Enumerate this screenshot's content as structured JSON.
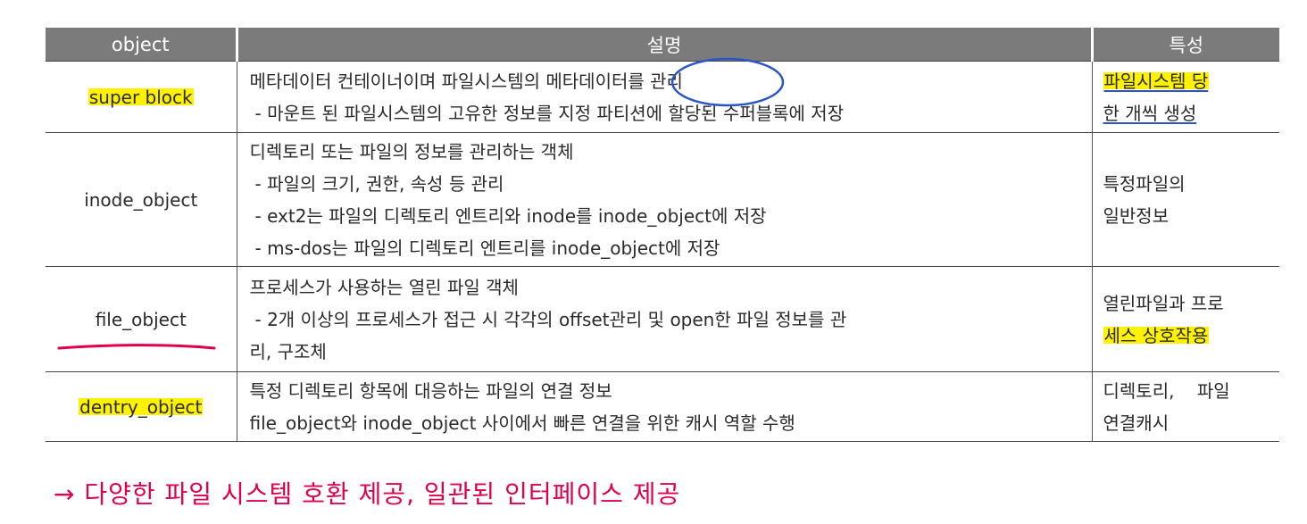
{
  "table": {
    "headers": {
      "object": "object",
      "desc": "설명",
      "trait": "특성"
    },
    "rows": {
      "super_block": {
        "object": "super block",
        "desc1": "메타데이터 컨테이너이며 파일시스템의 메타데이터를 관리",
        "desc2": "- 마운트 된 파일시스템의 고유한 정보를 지정 파티션에 할당된 수퍼블록에 저장",
        "trait1": "파일시스템 당",
        "trait2": "한 개씩 생성"
      },
      "inode": {
        "object": "inode_object",
        "desc1": "디렉토리 또는 파일의 정보를 관리하는 객체",
        "desc2": "- 파일의 크기, 권한, 속성 등 관리",
        "desc3": "- ext2는 파일의 디렉토리 엔트리와 inode를 inode_object에 저장",
        "desc4": "- ms-dos는 파일의 디렉토리 엔트리를 inode_object에 저장",
        "trait1": "특정파일의",
        "trait2": "일반정보"
      },
      "file": {
        "object": "file_object",
        "desc1": "프로세스가 사용하는 열린 파일 객체",
        "desc2": "- 2개 이상의 프로세스가 접근 시 각각의 offset관리 및 open한 파일 정보를 관",
        "desc3": "리, 구조체",
        "trait1": "열린파일과 프로",
        "trait2": "세스 상호작용"
      },
      "dentry": {
        "object": "dentry_object",
        "desc1": "특정 디렉토리 항목에 대응하는 파일의 연결 정보",
        "desc2": "file_object와 inode_object 사이에서 빠른 연결을 위한 캐시 역할 수행",
        "trait1": "디렉토리,    파일",
        "trait2": "연결캐시"
      }
    }
  },
  "handwritten_note": "→ 다양한 파일 시스템 호환 제공, 일관된 인터페이스 제공",
  "colors": {
    "header_bg": "#7b7b7b",
    "highlight": "#fff200",
    "pen_blue": "#2a55c9",
    "pen_red": "#e0004a"
  }
}
